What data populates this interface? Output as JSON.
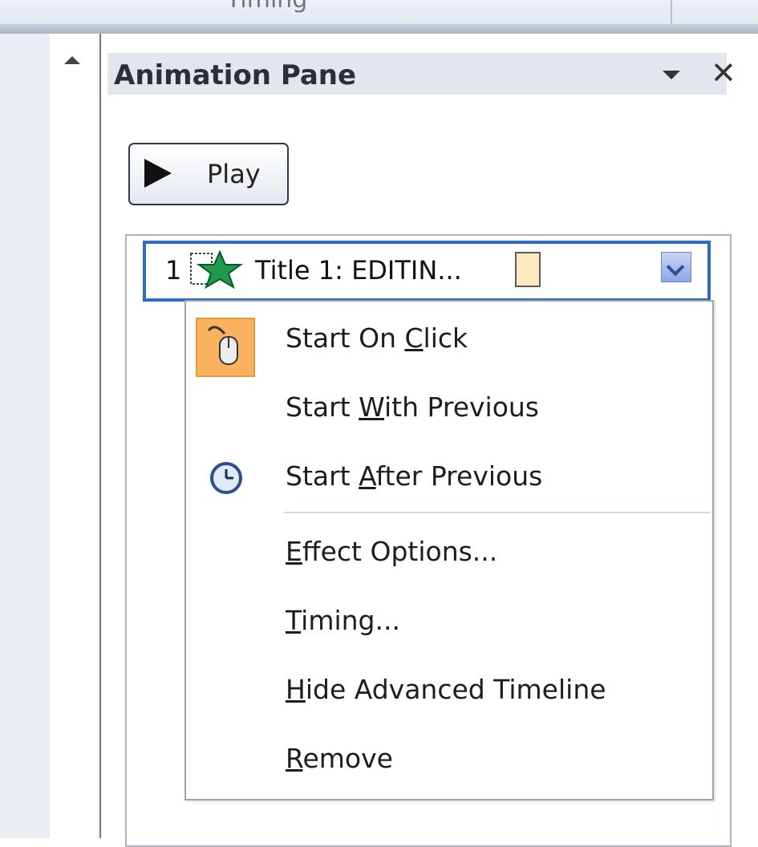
{
  "ribbon": {
    "group_label": "Timing"
  },
  "pane": {
    "title": "Animation Pane",
    "play_label": "Play"
  },
  "animation_item": {
    "number": "1",
    "label": "Title 1: EDITIN..."
  },
  "menu": {
    "items": [
      {
        "pre": "Start On ",
        "key": "C",
        "post": "lick",
        "icon": "mouse-click-icon",
        "selected": true
      },
      {
        "pre": "Start ",
        "key": "W",
        "post": "ith Previous",
        "icon": ""
      },
      {
        "pre": "Start ",
        "key": "A",
        "post": "fter Previous",
        "icon": "clock-icon"
      },
      {
        "pre": "",
        "key": "E",
        "post": "ffect Options...",
        "icon": ""
      },
      {
        "pre": "",
        "key": "T",
        "post": "iming...",
        "icon": ""
      },
      {
        "pre": "",
        "key": "H",
        "post": "ide Advanced Timeline",
        "icon": ""
      },
      {
        "pre": "",
        "key": "R",
        "post": "emove",
        "icon": ""
      }
    ]
  },
  "colors": {
    "selection_border": "#2f6cc1",
    "highlight": "#fbb25f",
    "timeline_bar": "#fde9c0"
  }
}
